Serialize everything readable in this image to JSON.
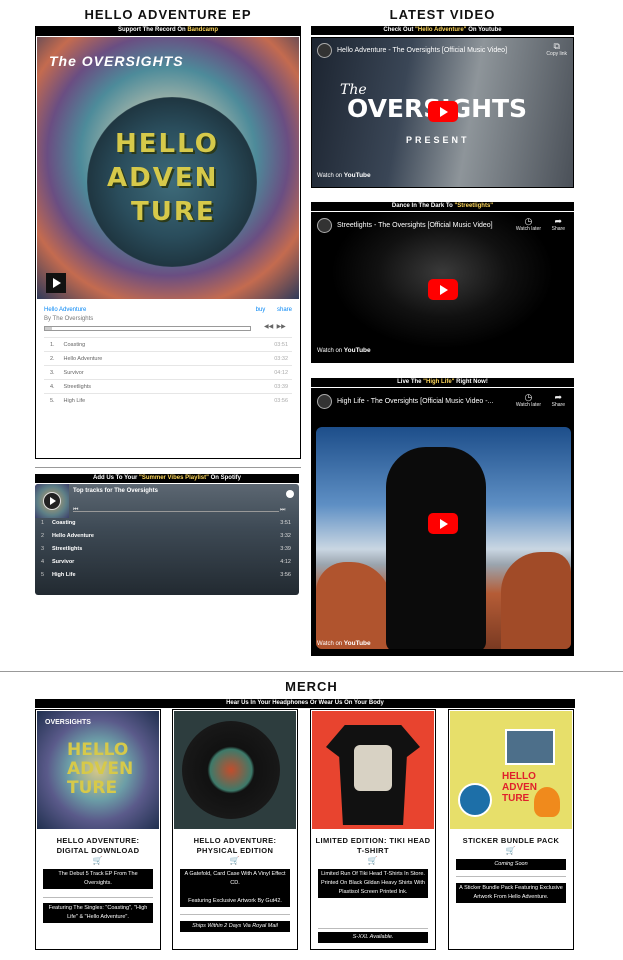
{
  "left_column": {
    "title": "HELLO ADVENTURE EP",
    "bandcamp_banner_prefix": "Support The Record On ",
    "bandcamp_banner_link": "Bandcamp",
    "bandcamp": {
      "album_brand": "The OVERSIGHTS",
      "album_title": "Hello Adventure",
      "artist": "By The Oversights",
      "buy_label": "buy",
      "share_label": "share",
      "tracks": [
        {
          "num": "1.",
          "title": "Coasting",
          "duration": "03:51"
        },
        {
          "num": "2.",
          "title": "Hello Adventure",
          "duration": "03:32"
        },
        {
          "num": "3.",
          "title": "Survivor",
          "duration": "04:12"
        },
        {
          "num": "4.",
          "title": "Streetlights",
          "duration": "03:39"
        },
        {
          "num": "5.",
          "title": "High Life",
          "duration": "03:56"
        }
      ]
    },
    "spotify_banner_prefix": "Add Us To Your ",
    "spotify_banner_highlight": "\"Summer Vibes Playlist\"",
    "spotify_banner_suffix": " On Spotify",
    "spotify": {
      "title": "Top tracks for The Oversights",
      "tracks": [
        {
          "num": "1",
          "title": "Coasting",
          "duration": "3:51"
        },
        {
          "num": "2",
          "title": "Hello Adventure",
          "duration": "3:32"
        },
        {
          "num": "3",
          "title": "Streetlights",
          "duration": "3:39"
        },
        {
          "num": "4",
          "title": "Survivor",
          "duration": "4:12"
        },
        {
          "num": "5",
          "title": "High Life",
          "duration": "3:56"
        }
      ]
    }
  },
  "right_column": {
    "title": "LATEST VIDEO",
    "videos": [
      {
        "banner_prefix": "Check Out ",
        "banner_highlight": "\"Hello Adventure\"",
        "banner_suffix": " On Youtube",
        "title": "Hello Adventure - The Oversights [Official Music Video]",
        "tool_label": "Copy link",
        "overlay_the": "The",
        "overlay_band": "OVERSIGHTS",
        "overlay_present": "PRESENT"
      },
      {
        "banner_prefix": "Dance In The Dark To ",
        "banner_highlight": "\"Streetlights\"",
        "banner_suffix": "",
        "title": "Streetlights - The Oversights [Official Music Video]",
        "watch_later": "Watch later",
        "share": "Share"
      },
      {
        "banner_prefix": "Live The ",
        "banner_highlight": "\"High Life\"",
        "banner_suffix": " Right Now!",
        "title": "High Life - The Oversights [Official Music Video -...",
        "watch_later": "Watch later",
        "share": "Share"
      }
    ],
    "watch_on": "Watch on",
    "youtube_brand": "YouTube"
  },
  "merch": {
    "title": "MERCH",
    "banner": "Hear Us In Your Headphones Or Wear Us On Your Body",
    "items": [
      {
        "name": "HELLO ADVENTURE: DIGITAL DOWNLOAD",
        "desc1": "The Debut 5 Track EP From The Oversights.",
        "desc2": "Featuring The Singles: \"Coasting\", \"High Life\" & \"Hello Adventure\"."
      },
      {
        "name": "HELLO ADVENTURE: PHYSICAL EDITION",
        "desc1": "A Gatefold, Card Case With A Vinyl Effect CD.",
        "desc2": "Featuring Exclusive Artwork By Gut42.",
        "note": "Ships Within 2 Days Via Royal Mail"
      },
      {
        "name": "LIMITED EDITION: TIKI HEAD T-SHIRT",
        "desc1": "Limited Run Of Tiki Head T-Shirts In Store.",
        "desc2": "Printed On Black Gildan Heavy Shirts With Plastisol Screen Printed Ink.",
        "note": "S-XXL Available."
      },
      {
        "name": "STICKER BUNDLE PACK",
        "status": "Coming Soon",
        "desc1": "A Sticker Bundle Pack Featuring Exclusive Artwork From Hello Adventure."
      }
    ]
  },
  "colors": {
    "bandcamp_link": "#0687f5",
    "youtube_red": "#ff0000",
    "banner_highlight": "#ffd85c"
  }
}
